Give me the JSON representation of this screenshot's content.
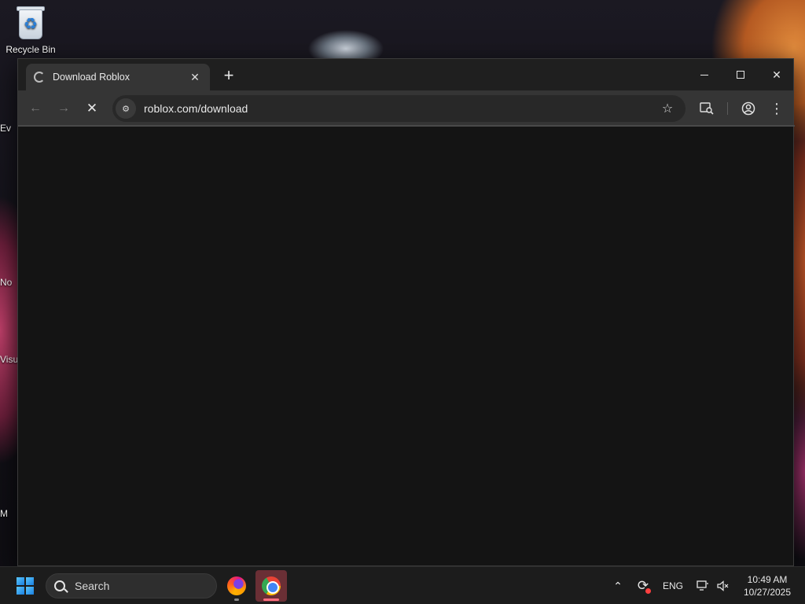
{
  "desktop": {
    "icons": [
      {
        "label": "Recycle Bin",
        "icon": "recycle-bin-icon"
      }
    ],
    "partial_labels": [
      "Ev",
      "No",
      "Visu",
      "M"
    ]
  },
  "browser": {
    "tab": {
      "title": "Download Roblox",
      "favicon": "loading-spinner-icon"
    },
    "new_tab_symbol": "+",
    "address": {
      "url": "roblox.com/download"
    },
    "nav": {
      "back": "back-arrow-icon",
      "forward": "forward-arrow-icon",
      "stop": "stop-loading-icon"
    },
    "toolbar_icons": [
      "bookmark-star-icon",
      "google-lens-icon",
      "profile-icon",
      "menu-icon"
    ],
    "content_state": "blank-loading"
  },
  "taskbar": {
    "search": {
      "placeholder": "Search"
    },
    "pinned_apps": [
      {
        "name": "Firefox",
        "icon": "firefox-icon",
        "running": true
      },
      {
        "name": "Google Chrome",
        "icon": "chrome-icon",
        "active": true
      }
    ],
    "tray": {
      "language": "ENG",
      "time": "10:49 AM",
      "date": "10/27/2025"
    }
  },
  "colors": {
    "window_bg": "#1f1f1f",
    "toolbar_bg": "#353535",
    "content_bg": "#141414",
    "active_app_bg": "#6a2f35",
    "active_indicator": "#ff6f7f"
  }
}
